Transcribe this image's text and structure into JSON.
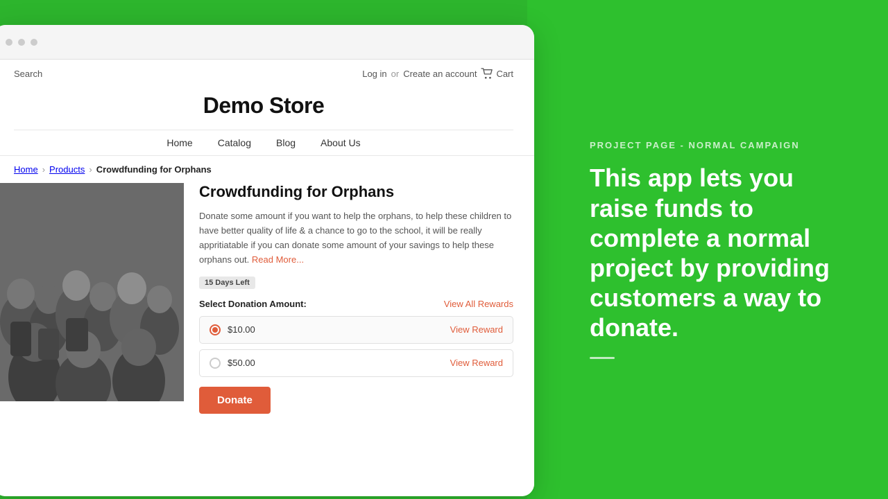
{
  "background": {
    "color": "#2ec02e"
  },
  "browser": {
    "dot_color": "#ccc"
  },
  "store": {
    "search_label": "Search",
    "login_label": "Log in",
    "or_label": "or",
    "create_account_label": "Create an account",
    "cart_label": "Cart",
    "title": "Demo Store",
    "nav": [
      {
        "label": "Home",
        "href": "#"
      },
      {
        "label": "Catalog",
        "href": "#"
      },
      {
        "label": "Blog",
        "href": "#"
      },
      {
        "label": "About Us",
        "href": "#"
      }
    ],
    "breadcrumb": [
      {
        "label": "Home",
        "href": "#"
      },
      {
        "label": "Products",
        "href": "#"
      },
      {
        "label": "Crowdfunding for Orphans",
        "current": true
      }
    ]
  },
  "product": {
    "title": "Crowdfunding for Orphans",
    "description": "Donate some amount if you want to help the orphans, to help these children to have better quality of life & a chance to go to the school, it will be really appritiatable if you can donate some amount of your savings to help these orphans out.",
    "read_more_label": "Read More...",
    "days_badge": "15 Days Left",
    "donation_label": "Select Donation Amount:",
    "view_all_rewards_label": "View All Rewards",
    "options": [
      {
        "amount": "$10.00",
        "selected": true,
        "view_reward_label": "View Reward"
      },
      {
        "amount": "$50.00",
        "selected": false,
        "view_reward_label": "View Reward"
      }
    ],
    "donate_button_label": "Donate"
  },
  "right_panel": {
    "subtitle": "PROJECT PAGE - NORMAL CAMPAIGN",
    "main_text": "This app lets you raise funds to complete a normal project by providing customers a way to donate."
  }
}
